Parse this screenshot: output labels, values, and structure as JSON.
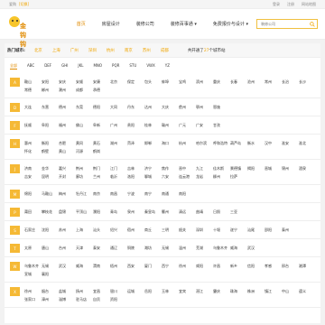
{
  "topbar": {
    "site": "爱购",
    "location": "[切换]",
    "links": [
      "登录",
      "注册",
      "网站地图"
    ]
  },
  "logo": {
    "text": "金钩钩"
  },
  "nav": [
    {
      "label": "首页",
      "active": true
    },
    {
      "label": "房屋设计",
      "active": false
    },
    {
      "label": "装修公司",
      "active": false
    },
    {
      "label": "装修百事通 ▾",
      "active": false
    },
    {
      "label": "免费报价与设计 ▾",
      "active": false
    }
  ],
  "search": {
    "placeholder": "装修公司"
  },
  "subbar": {
    "hot_label": "热门城市:",
    "hot_cities": [
      "北京",
      "上海",
      "广州",
      "深圳",
      "杭州",
      "南京",
      "苏州",
      "成都"
    ],
    "all_prefix": "共开通了",
    "all_count": "27",
    "all_suffix": "个城市站"
  },
  "letters": [
    "全部",
    "ABC",
    "DEF",
    "GHI",
    "JKL",
    "MNO",
    "PQR",
    "STU",
    "VWX",
    "YZ"
  ],
  "groups": [
    {
      "badge": "A",
      "cities": [
        "鞍山",
        "安阳",
        "安庆",
        "安顺",
        "安康",
        "北京",
        "保定",
        "包头",
        "蚌埠",
        "宝鸡",
        "滨州",
        "重庆",
        "长春",
        "沧州",
        "常州",
        "长治",
        "长沙",
        "常德",
        "郴州",
        "潮州",
        "成都",
        "承德"
      ]
    },
    {
      "badge": "D",
      "cities": [
        "大连",
        "东营",
        "德州",
        "东莞",
        "德阳",
        "大同",
        "丹东",
        "达州",
        "大庆",
        "儋州",
        "鄂州",
        "恩施"
      ]
    },
    {
      "badge": "F",
      "cities": [
        "抚顺",
        "阜阳",
        "福州",
        "佛山",
        "阜新",
        "广州",
        "贵阳",
        "桂林",
        "赣州",
        "广元",
        "广安",
        "甘孜"
      ]
    },
    {
      "badge": "H",
      "cities": [
        "惠州",
        "衡阳",
        "合肥",
        "黄冈",
        "黄石",
        "湖州",
        "菏泽",
        "邯郸",
        "海口",
        "杭州",
        "哈尔滨",
        "呼和浩特",
        "葫芦岛",
        "衡水",
        "汉中",
        "淮安",
        "淮北",
        "怀化",
        "鹤壁",
        "黄山",
        "河源",
        "鹤岗"
      ]
    },
    {
      "badge": "J",
      "cities": [
        "济南",
        "金华",
        "嘉兴",
        "荆州",
        "荆门",
        "江门",
        "吉林",
        "济宁",
        "焦作",
        "晋中",
        "九江",
        "佳木斯",
        "景德镇",
        "揭阳",
        "晋城",
        "锦州",
        "酒泉",
        "吉安",
        "昆明",
        "开封",
        "廊坊",
        "兰州",
        "临沂",
        "洛阳",
        "聊城",
        "六安",
        "连云港",
        "龙岩",
        "柳州",
        "拉萨"
      ]
    },
    {
      "badge": "M",
      "cities": [
        "绵阳",
        "马鞍山",
        "梅州",
        "牡丹江",
        "南京",
        "南昌",
        "宁波",
        "南宁",
        "南通",
        "南阳"
      ]
    },
    {
      "badge": "P",
      "cities": [
        "莆田",
        "攀枝花",
        "盘锦",
        "平顶山",
        "濮阳",
        "青岛",
        "泉州",
        "秦皇岛",
        "衢州",
        "清远",
        "曲靖",
        "日照",
        "三亚"
      ]
    },
    {
      "badge": "S",
      "cities": [
        "石家庄",
        "沈阳",
        "苏州",
        "上海",
        "汕头",
        "绍兴",
        "宿州",
        "商丘",
        "三明",
        "韶关",
        "深圳",
        "十堰",
        "遂宁",
        "汕尾",
        "邵阳",
        "泰州"
      ]
    },
    {
      "badge": "T",
      "cities": [
        "太原",
        "唐山",
        "台州",
        "天津",
        "泰安",
        "通辽",
        "铜陵",
        "潍坊",
        "无锡",
        "温州",
        "芜湖",
        "乌鲁木齐",
        "威海",
        "武汉"
      ]
    },
    {
      "badge": "W",
      "cities": [
        "乌鲁木齐",
        "无锡",
        "武汉",
        "威海",
        "渭南",
        "梧州",
        "西安",
        "厦门",
        "西宁",
        "徐州",
        "咸阳",
        "许昌",
        "新乡",
        "信阳",
        "孝感",
        "邢台",
        "湘潭",
        "宣城",
        "襄阳"
      ]
    },
    {
      "badge": "X",
      "cities": [
        "徐州",
        "烟台",
        "盐城",
        "扬州",
        "宜昌",
        "银川",
        "运城",
        "岳阳",
        "玉林",
        "宜宾",
        "湛江",
        "肇庆",
        "珠海",
        "株洲",
        "镇江",
        "中山",
        "遵义",
        "张家口",
        "漳州",
        "淄博",
        "驻马店",
        "自贡",
        "资阳"
      ]
    }
  ]
}
